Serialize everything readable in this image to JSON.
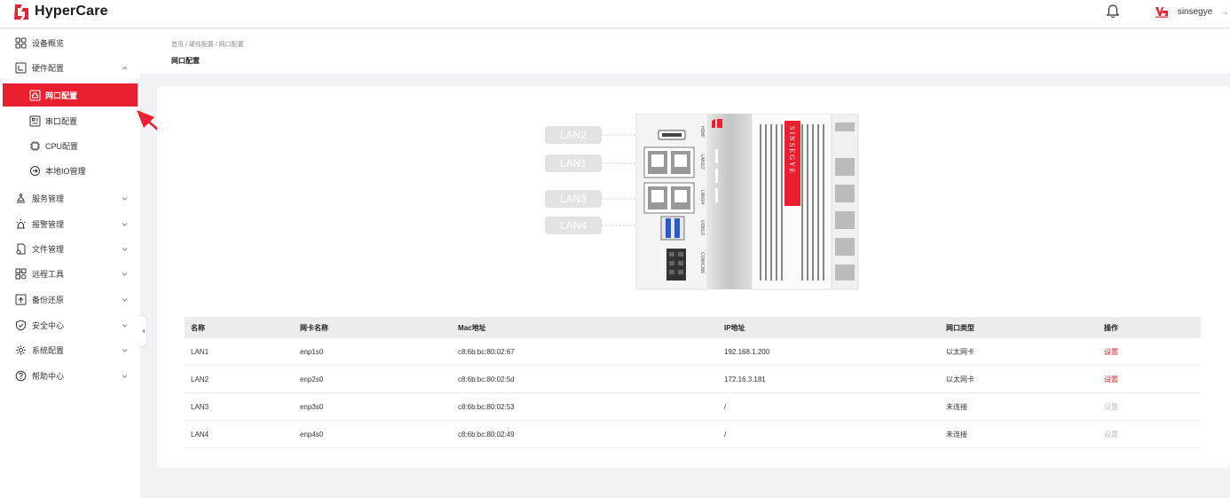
{
  "app": {
    "name": "HyperCare",
    "user": "sinsegye",
    "brand_color": "#e8202f"
  },
  "sidebar": {
    "items": [
      {
        "label": "设备概览",
        "icon": "grid-icon"
      },
      {
        "label": "硬件配置",
        "icon": "hardware-icon",
        "expanded": true
      },
      {
        "label": "网口配置",
        "icon": "network-port-icon",
        "active": true,
        "sub": true
      },
      {
        "label": "串口配置",
        "icon": "serial-port-icon",
        "sub": true
      },
      {
        "label": "CPU配置",
        "icon": "cpu-icon",
        "sub": true
      },
      {
        "label": "本地IO管理",
        "icon": "io-icon",
        "sub": true
      },
      {
        "label": "服务管理",
        "icon": "service-icon"
      },
      {
        "label": "报警管理",
        "icon": "alarm-icon"
      },
      {
        "label": "文件管理",
        "icon": "file-icon"
      },
      {
        "label": "远程工具",
        "icon": "remote-tool-icon"
      },
      {
        "label": "备份还原",
        "icon": "backup-icon"
      },
      {
        "label": "安全中心",
        "icon": "shield-icon"
      },
      {
        "label": "系统配置",
        "icon": "system-config-icon"
      },
      {
        "label": "帮助中心",
        "icon": "help-icon"
      }
    ]
  },
  "breadcrumb": {
    "text": "首页 / 硬件配置 / 网口配置"
  },
  "page": {
    "title": "网口配置"
  },
  "device": {
    "ports": [
      "LAN2",
      "LAN1",
      "LAN3",
      "LAN4"
    ],
    "port_labels": [
      "HDMI",
      "LAN1/2",
      "LAN3/4",
      "USB1/2",
      "COM/CAN"
    ],
    "brand_text": "SINSEGYE"
  },
  "table": {
    "headers": [
      "名称",
      "网卡名称",
      "Mac地址",
      "IP地址",
      "网口类型",
      "操作"
    ],
    "rows": [
      {
        "name": "LAN1",
        "nic": "enp1s0",
        "mac": "c8:6b:bc:80:02:67",
        "ip": "192.168.1.200",
        "type": "以太网卡",
        "action": "设置",
        "enabled": true
      },
      {
        "name": "LAN2",
        "nic": "enp2s0",
        "mac": "c8:6b:bc:80:02:5d",
        "ip": "172.16.3.181",
        "type": "以太网卡",
        "action": "设置",
        "enabled": true
      },
      {
        "name": "LAN3",
        "nic": "enp3s0",
        "mac": "c8:6b:bc:80:02:53",
        "ip": "/",
        "type": "未连接",
        "action": "设置",
        "enabled": false
      },
      {
        "name": "LAN4",
        "nic": "enp4s0",
        "mac": "c8:6b:bc:80:02:49",
        "ip": "/",
        "type": "未连接",
        "action": "设置",
        "enabled": false
      }
    ]
  }
}
